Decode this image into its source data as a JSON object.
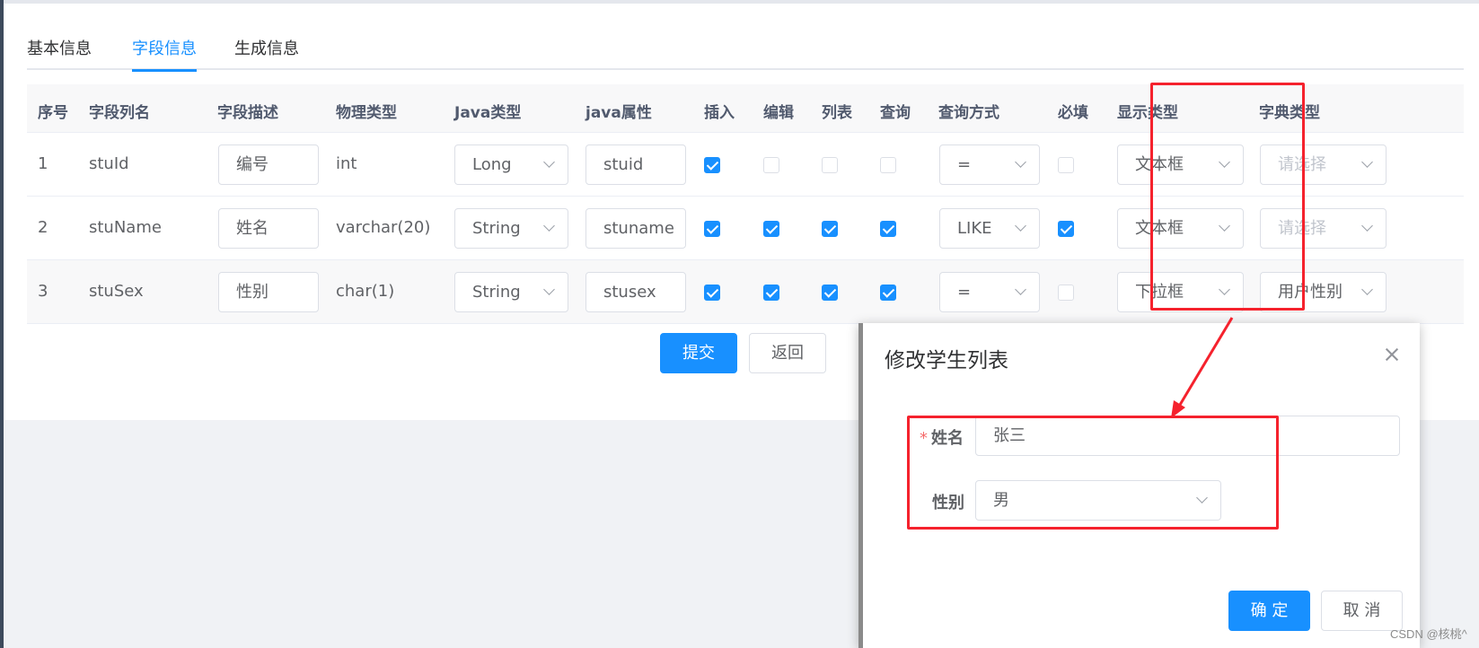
{
  "tabs": [
    {
      "label": "基本信息"
    },
    {
      "label": "字段信息",
      "active": true
    },
    {
      "label": "生成信息"
    }
  ],
  "table": {
    "headers": [
      "序号",
      "字段列名",
      "字段描述",
      "物理类型",
      "Java类型",
      "java属性",
      "插入",
      "编辑",
      "列表",
      "查询",
      "查询方式",
      "必填",
      "显示类型",
      "字典类型"
    ],
    "rows": [
      {
        "index": "1",
        "column": "stuId",
        "desc": "编号",
        "physical": "int",
        "java_type": "Long",
        "java_field": "stuid",
        "insert": true,
        "edit": false,
        "list": false,
        "query": false,
        "query_type": "=",
        "required": false,
        "html_type": "文本框",
        "dict_type": "请选择",
        "dict_placeholder": true
      },
      {
        "index": "2",
        "column": "stuName",
        "desc": "姓名",
        "physical": "varchar(20)",
        "java_type": "String",
        "java_field": "stuname",
        "insert": true,
        "edit": true,
        "list": true,
        "query": true,
        "query_type": "LIKE",
        "required": true,
        "html_type": "文本框",
        "dict_type": "请选择",
        "dict_placeholder": true
      },
      {
        "index": "3",
        "column": "stuSex",
        "desc": "性别",
        "physical": "char(1)",
        "java_type": "String",
        "java_field": "stusex",
        "insert": true,
        "edit": true,
        "list": true,
        "query": true,
        "query_type": "=",
        "required": false,
        "html_type": "下拉框",
        "dict_type": "用户性别",
        "dict_placeholder": false
      }
    ]
  },
  "actions": {
    "submit": "提交",
    "back": "返回"
  },
  "dialog": {
    "title": "修改学生列表",
    "fields": {
      "name": {
        "label": "姓名",
        "required_mark": "*",
        "value": "张三"
      },
      "sex": {
        "label": "性别",
        "value": "男"
      }
    },
    "confirm": "确 定",
    "cancel": "取 消"
  },
  "watermark": "CSDN @核桃^",
  "colors": {
    "primary": "#1890ff",
    "annotation_red": "#f5222d"
  }
}
